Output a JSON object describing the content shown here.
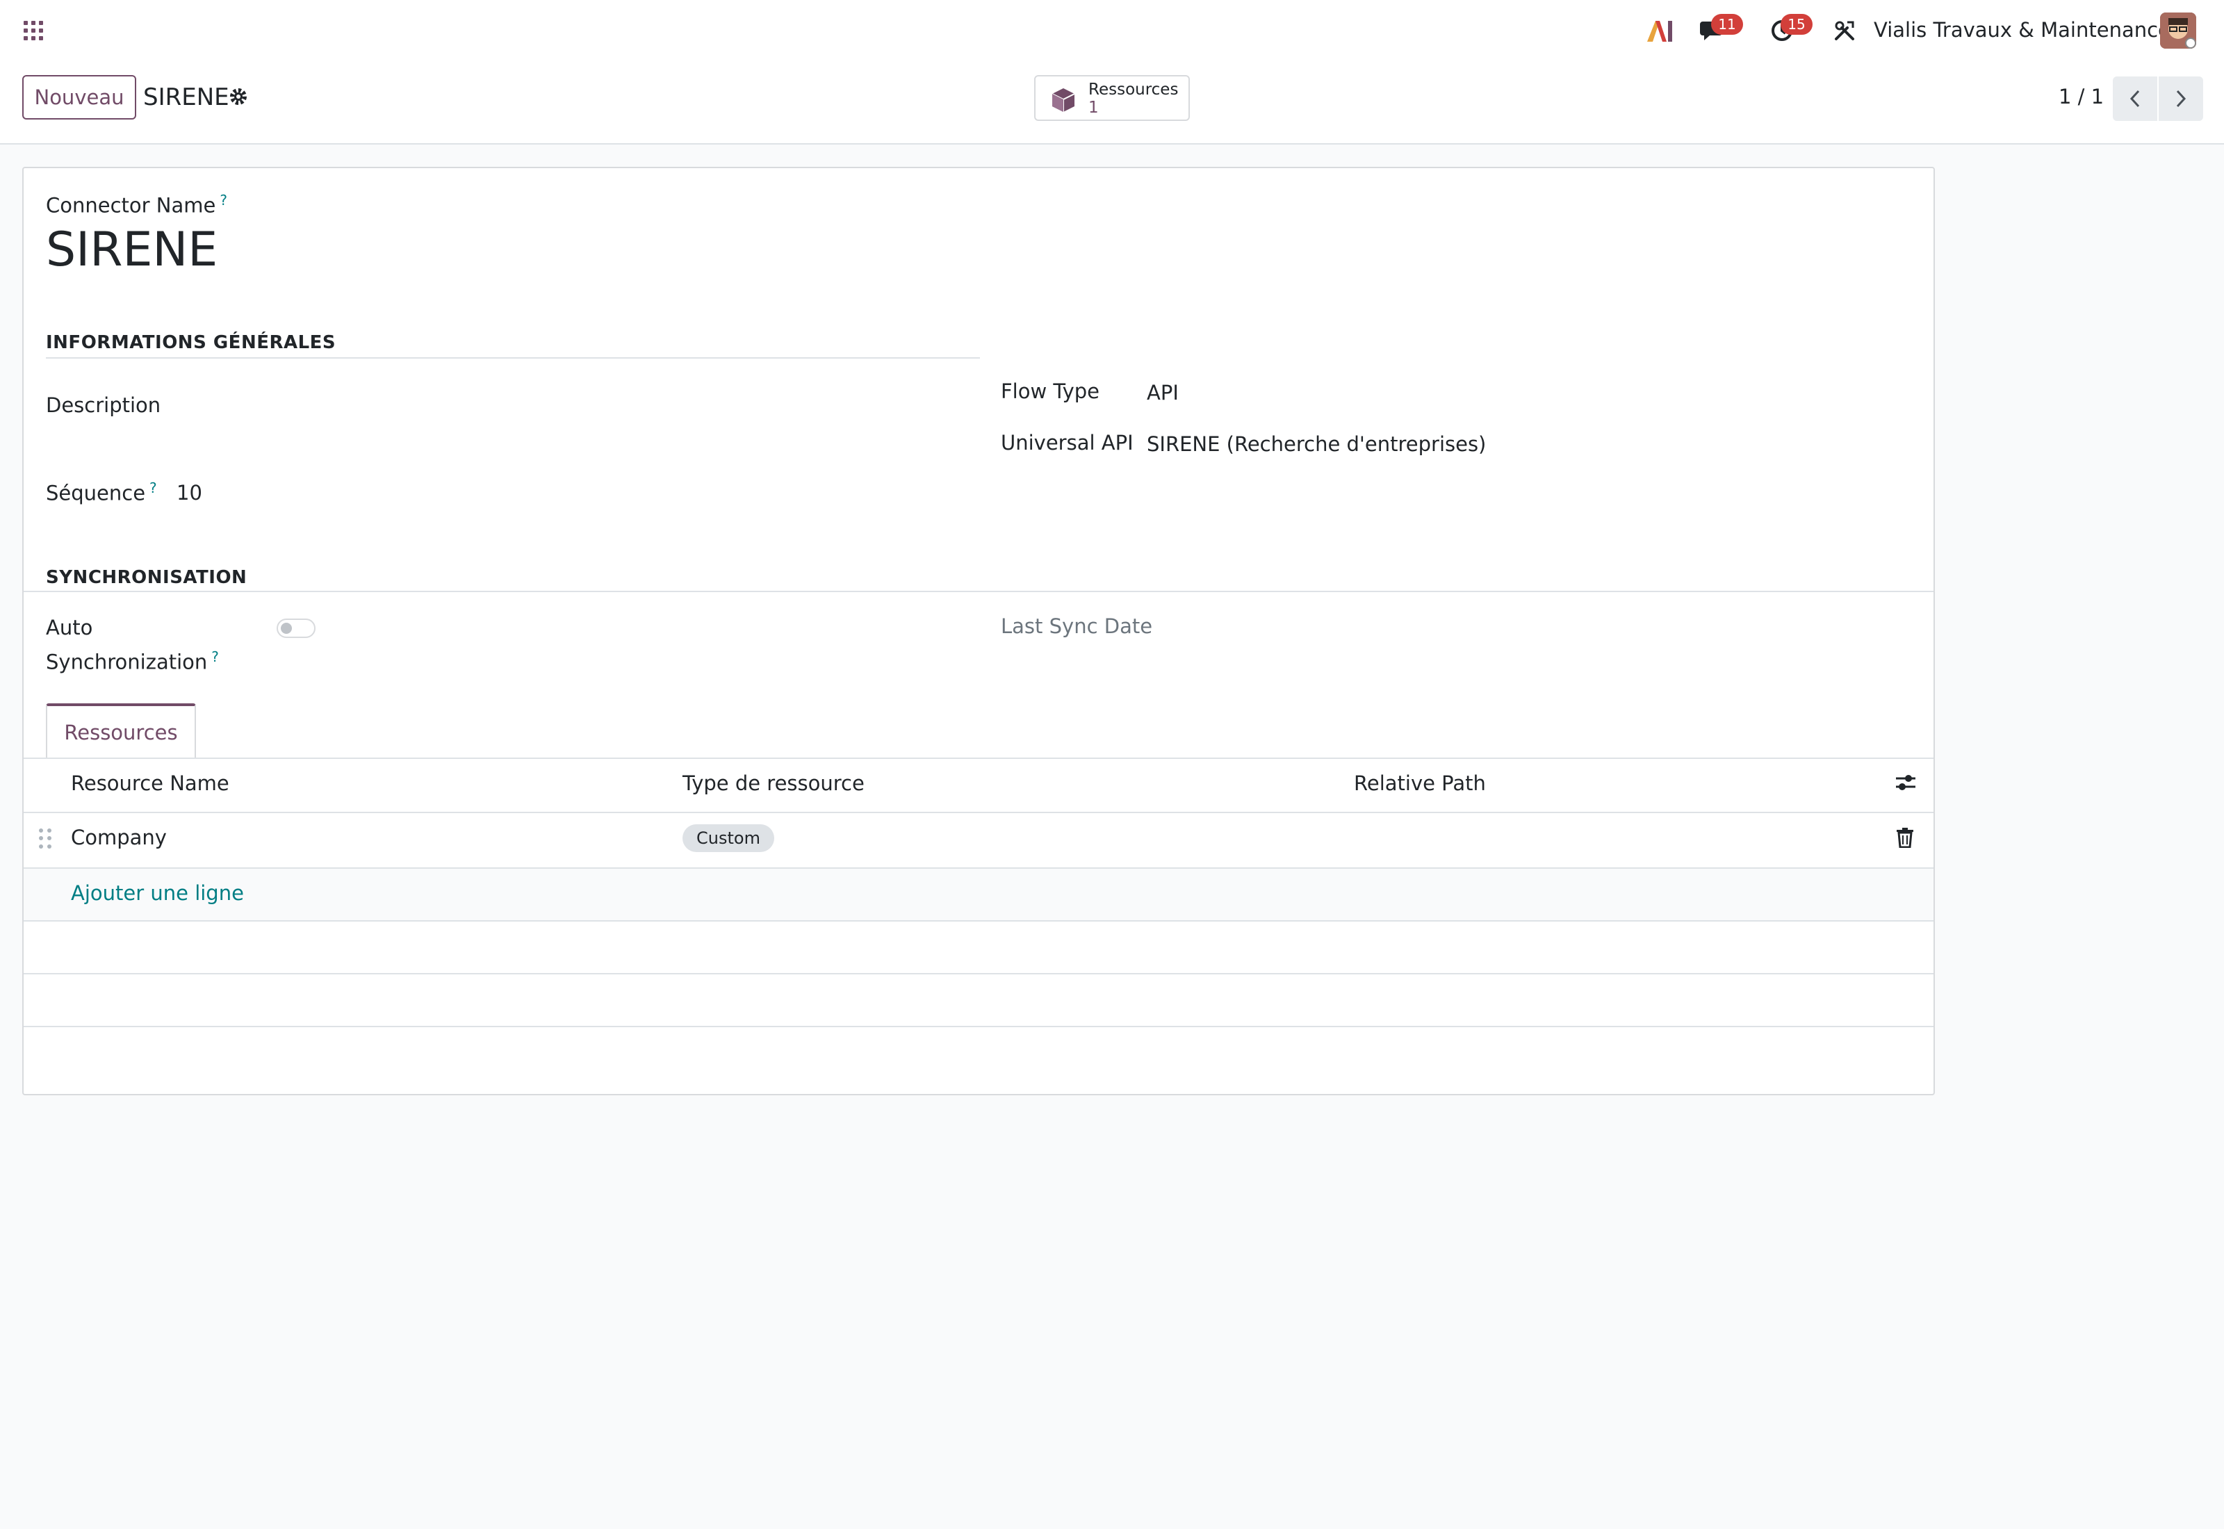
{
  "navbar": {
    "chat_badge": "11",
    "activity_badge": "15",
    "company_name": "Vialis Travaux & Maintenance"
  },
  "control_panel": {
    "new_button": "Nouveau",
    "record_title": "SIRENE",
    "smart_button": {
      "label": "Ressources",
      "count": "1"
    },
    "pager": "1 / 1"
  },
  "form": {
    "connector_name_label": "Connector Name",
    "connector_name": "SIRENE",
    "help_mark": "?",
    "section_general": "INFORMATIONS GÉNÉRALES",
    "description_label": "Description",
    "sequence_label": "Séquence",
    "sequence_value": "10",
    "flow_type_label": "Flow Type",
    "flow_type_value": "API",
    "universal_api_label": "Universal API",
    "universal_api_value": "SIRENE (Recherche d'entreprises)",
    "section_sync": "SYNCHRONISATION",
    "auto_sync_label_line1": "Auto",
    "auto_sync_label_line2": "Synchronization",
    "auto_sync_enabled": false,
    "last_sync_label": "Last Sync Date"
  },
  "tabs": [
    {
      "label": "Ressources",
      "active": true
    }
  ],
  "resources_table": {
    "columns": [
      "Resource Name",
      "Type de ressource",
      "Relative Path"
    ],
    "rows": [
      {
        "name": "Company",
        "type": "Custom",
        "path": ""
      }
    ],
    "add_line": "Ajouter une ligne"
  },
  "colors": {
    "brand": "#714b67",
    "link": "#017e84",
    "badge": "#d23f3a"
  }
}
